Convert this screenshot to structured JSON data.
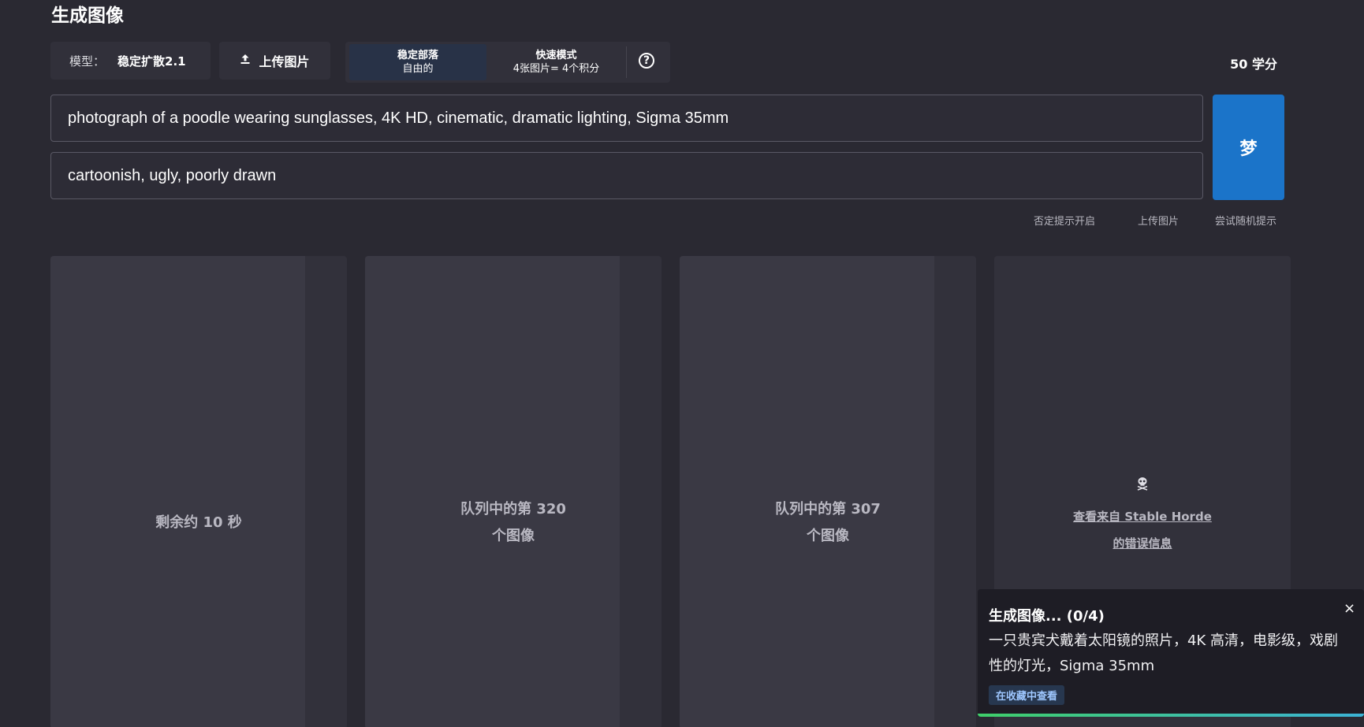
{
  "page": {
    "title": "生成图像"
  },
  "toolbar": {
    "model_label": "模型：",
    "model_value": "稳定扩散2.1",
    "upload_label": "上传图片",
    "modes": [
      {
        "title": "稳定部落",
        "subtitle": "自由的",
        "active": true
      },
      {
        "title": "快速模式",
        "subtitle": "4张图片= 4个积分",
        "active": false
      }
    ],
    "help_symbol": "?",
    "credits": "50 学分"
  },
  "prompts": {
    "positive": "photograph of a poodle wearing sunglasses, 4K HD, cinematic, dramatic lighting, Sigma 35mm",
    "negative": "cartoonish, ugly, poorly drawn"
  },
  "dream_button": "梦",
  "sub_links": [
    "否定提示开启",
    "上传图片",
    "尝试随机提示"
  ],
  "cards": [
    {
      "lines": [
        "剩余约 10 秒"
      ],
      "progress": 0.86
    },
    {
      "lines": [
        "队列中的第 320",
        "个图像"
      ],
      "progress": 0.86
    },
    {
      "lines": [
        "队列中的第 307",
        "个图像"
      ],
      "progress": 0.86
    },
    {
      "error_link_lines": [
        "查看来自 Stable Horde",
        "的错误信息"
      ]
    }
  ],
  "toast": {
    "title": "生成图像... (0/4)",
    "body": "一只贵宾犬戴着太阳镜的照片，4K 高清，电影级，戏剧性的灯光，Sigma 35mm",
    "button": "在收藏中查看",
    "close_symbol": "×",
    "progress": 1.0
  },
  "colors": {
    "background": "#2a2932",
    "accent": "#1b74c9",
    "active_mode": "#283247"
  }
}
